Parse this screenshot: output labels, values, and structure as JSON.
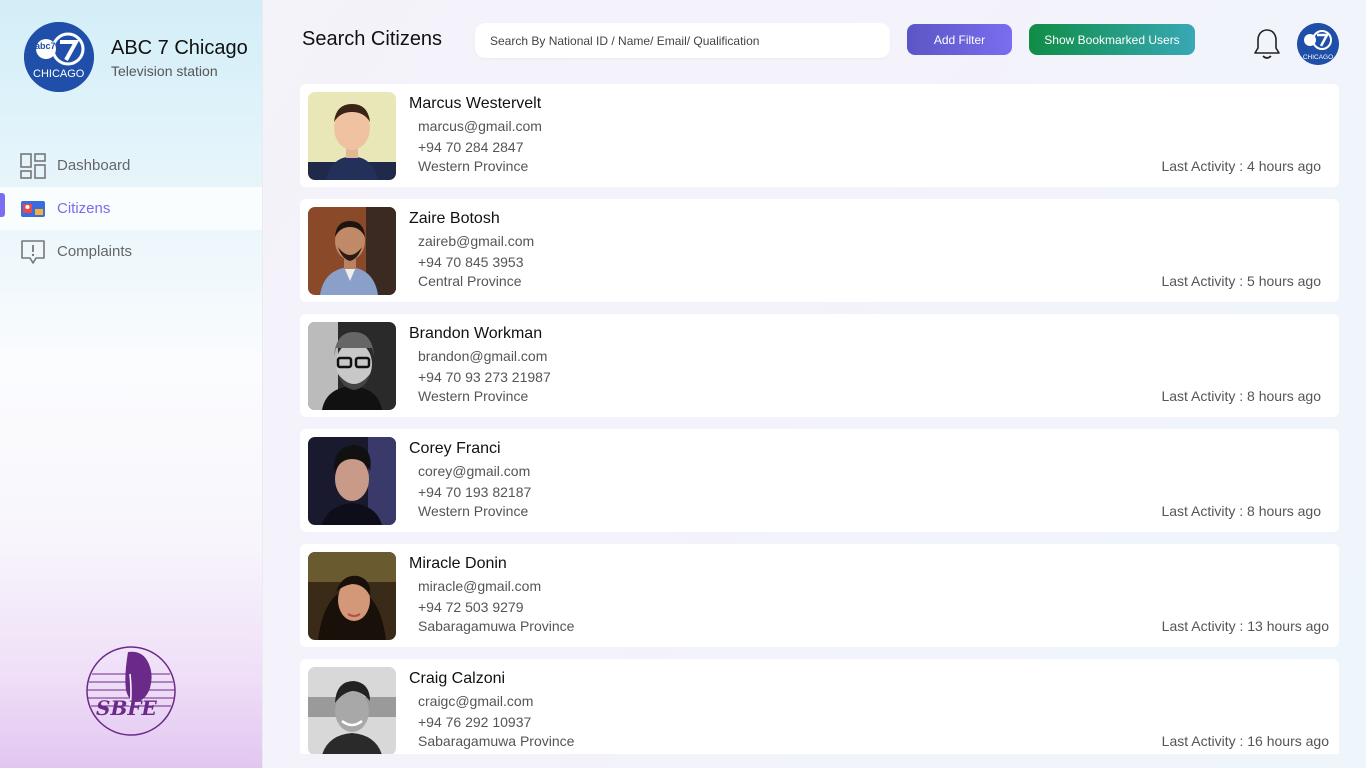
{
  "brand": {
    "logo_text": "abc7",
    "logo_sub": "CHICAGO",
    "title": "ABC 7 Chicago",
    "subtitle": "Television station"
  },
  "nav": [
    {
      "label": "Dashboard",
      "icon": "dashboard-grid-icon",
      "active": false
    },
    {
      "label": "Citizens",
      "icon": "citizens-card-icon",
      "active": true
    },
    {
      "label": "Complaints",
      "icon": "complaint-alert-icon",
      "active": false
    }
  ],
  "footer_logo": {
    "text": "SBFE"
  },
  "header": {
    "title": "Search Citizens",
    "search_placeholder": "Search By National ID / Name/ Email/ Qualification",
    "add_filter": "Add Filter",
    "show_bookmarked": "Show Bookmarked Users"
  },
  "citizens": [
    {
      "name": "Marcus Westervelt",
      "email": "marcus@gmail.com",
      "phone": "+94 70 284 2847",
      "province": "Western Province",
      "activity": "Last Activity : 4 hours ago"
    },
    {
      "name": "Zaire Botosh",
      "email": "zaireb@gmail.com",
      "phone": "+94 70 845 3953",
      "province": "Central Province",
      "activity": "Last Activity : 5 hours ago"
    },
    {
      "name": "Brandon Workman",
      "email": "brandon@gmail.com",
      "phone": "+94 70 93 273 21987",
      "province": "Western Province",
      "activity": "Last Activity : 8 hours ago"
    },
    {
      "name": "Corey Franci",
      "email": "corey@gmail.com",
      "phone": "+94 70 193 82187",
      "province": "Western Province",
      "activity": "Last Activity : 8 hours ago"
    },
    {
      "name": "Miracle Donin",
      "email": "miracle@gmail.com",
      "phone": "+94 72 503 9279",
      "province": "Sabaragamuwa Province",
      "activity": "Last Activity : 13 hours ago"
    },
    {
      "name": "Craig Calzoni",
      "email": "craigc@gmail.com",
      "phone": "+94 76 292 10937",
      "province": "Sabaragamuwa Province",
      "activity": "Last Activity : 16 hours ago"
    }
  ],
  "colors": {
    "accent": "#7a6df0",
    "brand_blue": "#1f4fa8",
    "filter_button": "#6260d6",
    "bookmark_button": "#1a9a63"
  }
}
